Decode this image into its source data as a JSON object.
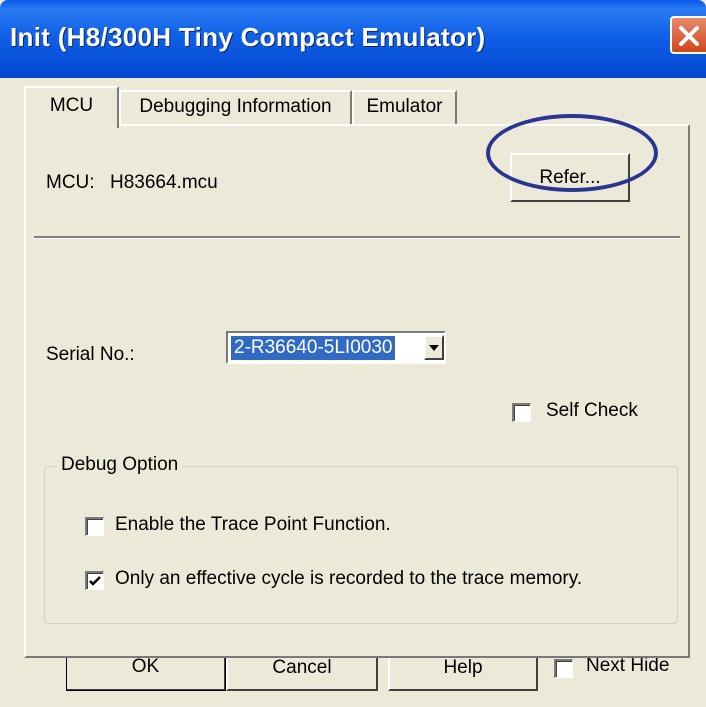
{
  "window": {
    "title": "Init (H8/300H Tiny Compact Emulator)",
    "close_icon": "close-icon"
  },
  "tabs": [
    {
      "label": "MCU",
      "active": true
    },
    {
      "label": "Debugging Information",
      "active": false
    },
    {
      "label": "Emulator",
      "active": false
    }
  ],
  "mcu": {
    "label": "MCU:",
    "value": "H83664.mcu",
    "refer_button": "Refer..."
  },
  "serial": {
    "label": "Serial No.:",
    "value": "2-R36640-5LI0030"
  },
  "self_check": {
    "label": "Self Check",
    "checked": false
  },
  "debug_option": {
    "legend": "Debug Option",
    "options": [
      {
        "label": "Enable the Trace Point Function.",
        "checked": false
      },
      {
        "label": "Only an effective cycle is recorded to the trace memory.",
        "checked": true
      }
    ]
  },
  "buttons": {
    "ok": "OK",
    "cancel": "Cancel",
    "help": "Help"
  },
  "next_hide": {
    "label": "Next Hide",
    "checked": false
  },
  "colors": {
    "title_bar": "#0a58e8",
    "selection": "#316ac5",
    "annotation_circle": "#283593"
  }
}
